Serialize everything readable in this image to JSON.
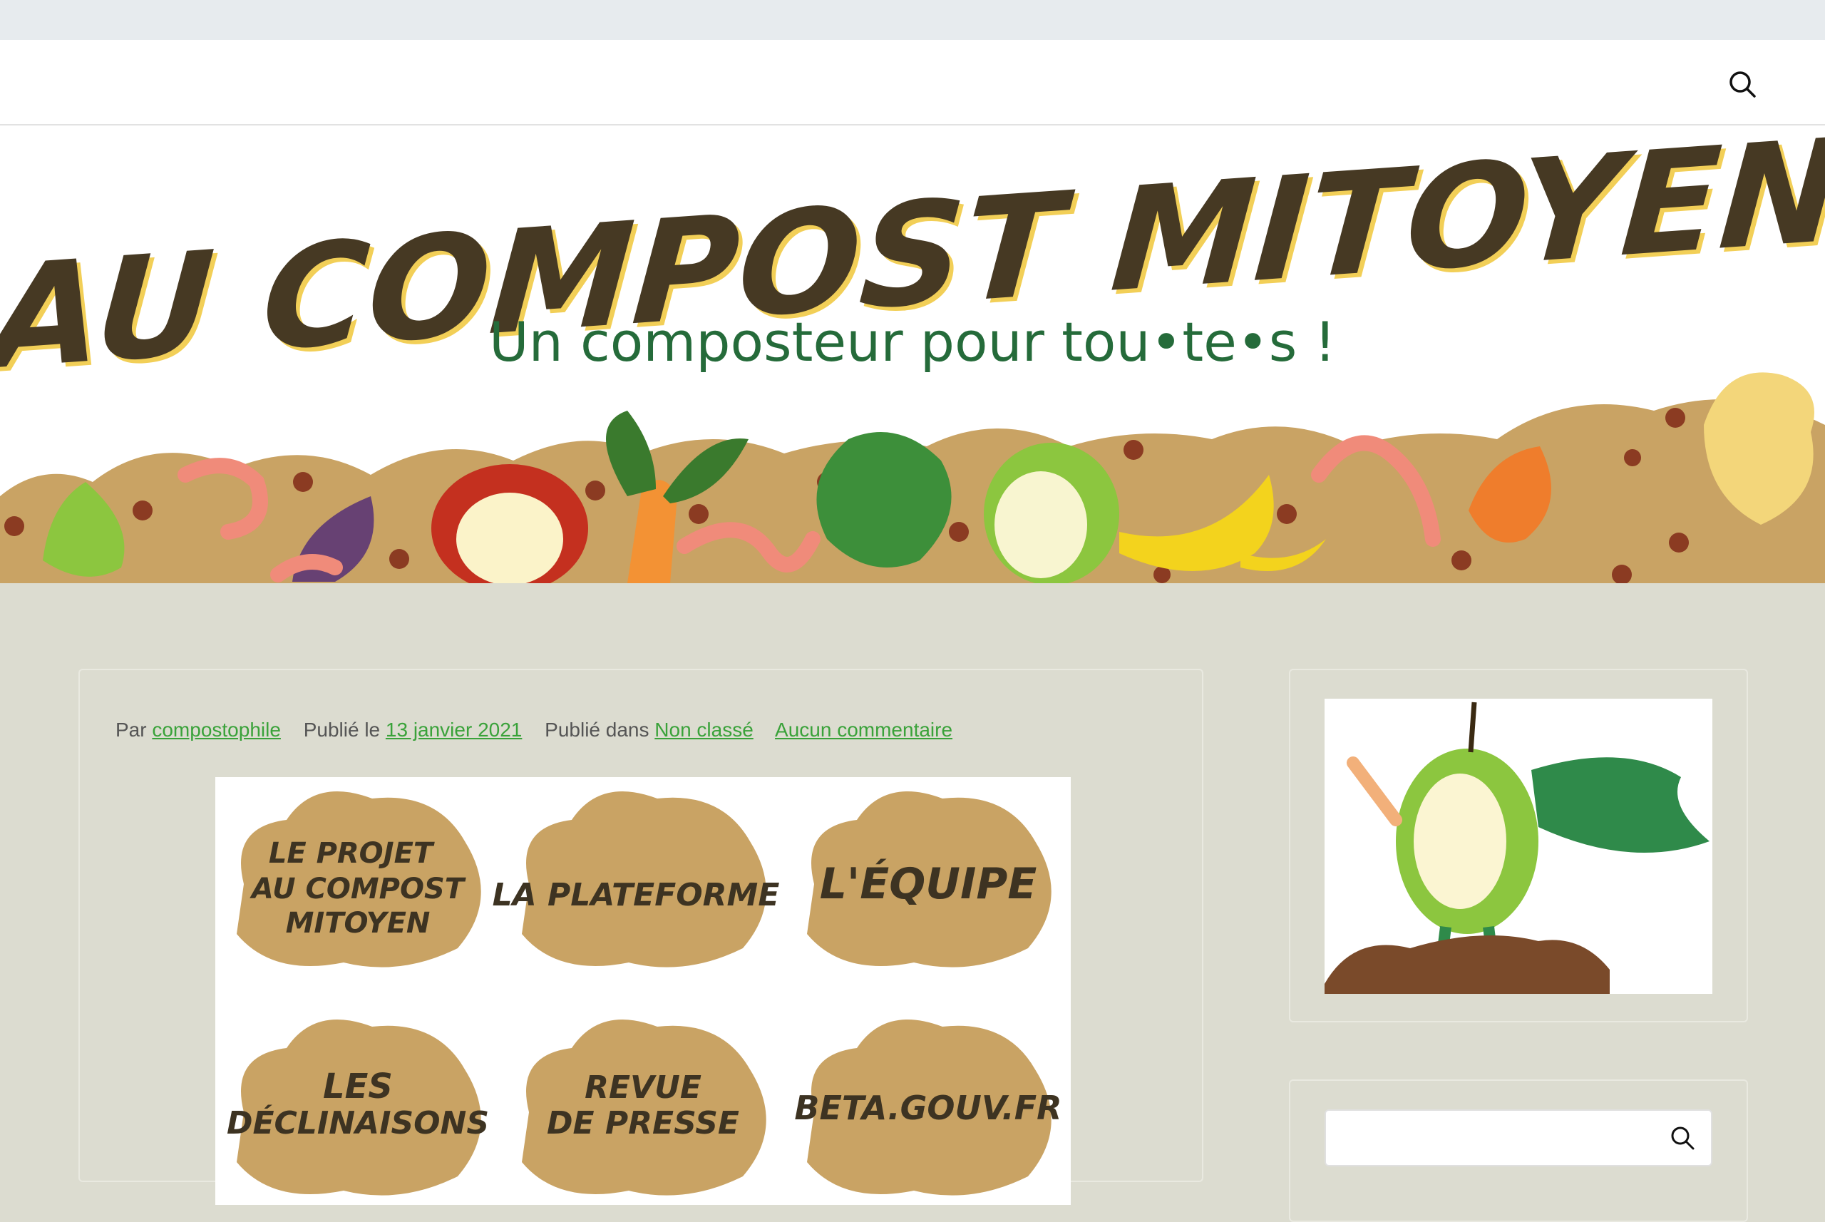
{
  "header": {
    "search_icon": "search-icon"
  },
  "banner": {
    "title": "AU COMPOST MITOYEN",
    "subtitle": "Un composteur pour tou•te•s !"
  },
  "post": {
    "meta": {
      "by_label": "Par",
      "author": "compostophile",
      "published_label": "Publié le",
      "date": "13 janvier 2021",
      "category_label": "Publié dans",
      "category": "Non classé",
      "comments": "Aucun commentaire"
    },
    "tiles": [
      {
        "line1": "LE PROJET",
        "line2": "AU COMPOST",
        "line3": "MITOYEN"
      },
      {
        "line1": "LA PLATEFORME",
        "line2": "",
        "line3": ""
      },
      {
        "line1": "L'ÉQUIPE",
        "line2": "",
        "line3": ""
      },
      {
        "line1": "LES",
        "line2": "DÉCLINAISONS",
        "line3": ""
      },
      {
        "line1": "REVUE",
        "line2": "DE PRESSE",
        "line3": ""
      },
      {
        "line1": "BETA.GOUV.FR",
        "line2": "",
        "line3": ""
      }
    ]
  },
  "sidebar": {
    "search_placeholder": "",
    "search_icon": "search-icon"
  },
  "colors": {
    "title_brown": "#463923",
    "title_yellow": "#f2cf57",
    "subtitle_green": "#256b3a",
    "compost_tan": "#c9a364",
    "link_green": "#3aa23a",
    "page_bg": "#dcdcd0"
  }
}
